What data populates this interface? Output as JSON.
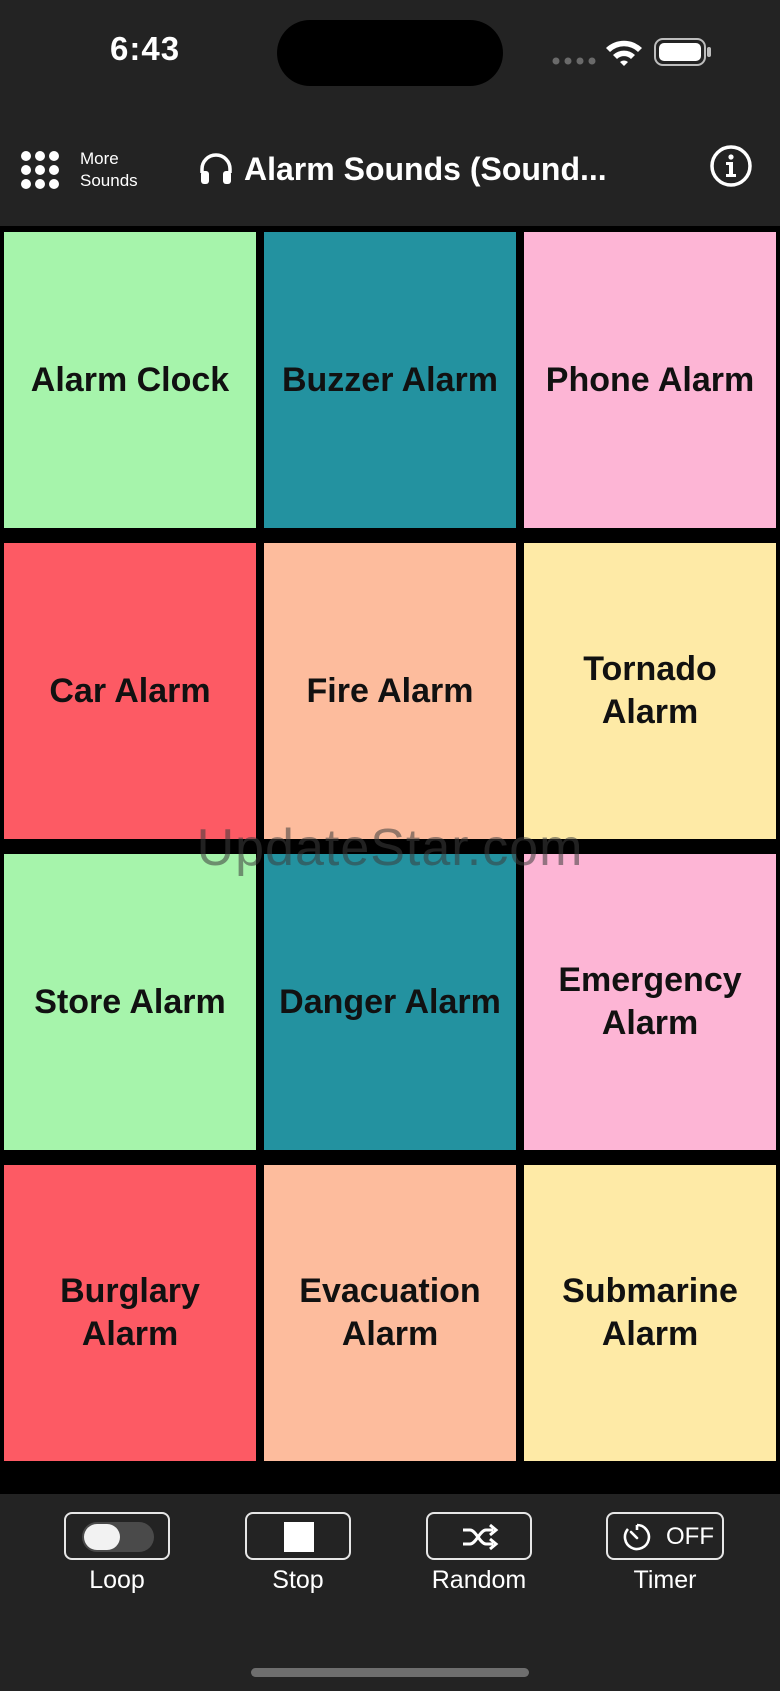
{
  "status_bar": {
    "time": "6:43"
  },
  "nav": {
    "more_label_line1": "More",
    "more_label_line2": "Sounds",
    "title": "Alarm Sounds (Sound..."
  },
  "tiles": [
    {
      "label": "Alarm Clock",
      "color": "#a6f4ab"
    },
    {
      "label": "Buzzer Alarm",
      "color": "#2392a0"
    },
    {
      "label": "Phone Alarm",
      "color": "#fdb5d5"
    },
    {
      "label": "Car Alarm",
      "color": "#fd5a64"
    },
    {
      "label": "Fire Alarm",
      "color": "#fdbc9d"
    },
    {
      "label": "Tornado Alarm",
      "color": "#feeaa6"
    },
    {
      "label": "Store Alarm",
      "color": "#a6f4ab"
    },
    {
      "label": "Danger Alarm",
      "color": "#2392a0"
    },
    {
      "label": "Emergency Alarm",
      "color": "#fdb5d5"
    },
    {
      "label": "Burglary Alarm",
      "color": "#fd5a64"
    },
    {
      "label": "Evacuation Alarm",
      "color": "#fdbc9d"
    },
    {
      "label": "Submarine Alarm",
      "color": "#feeaa6"
    }
  ],
  "watermark": "UpdateStar.com",
  "toolbar": {
    "loop_label": "Loop",
    "stop_label": "Stop",
    "random_label": "Random",
    "timer_label": "Timer",
    "timer_state": "OFF"
  }
}
